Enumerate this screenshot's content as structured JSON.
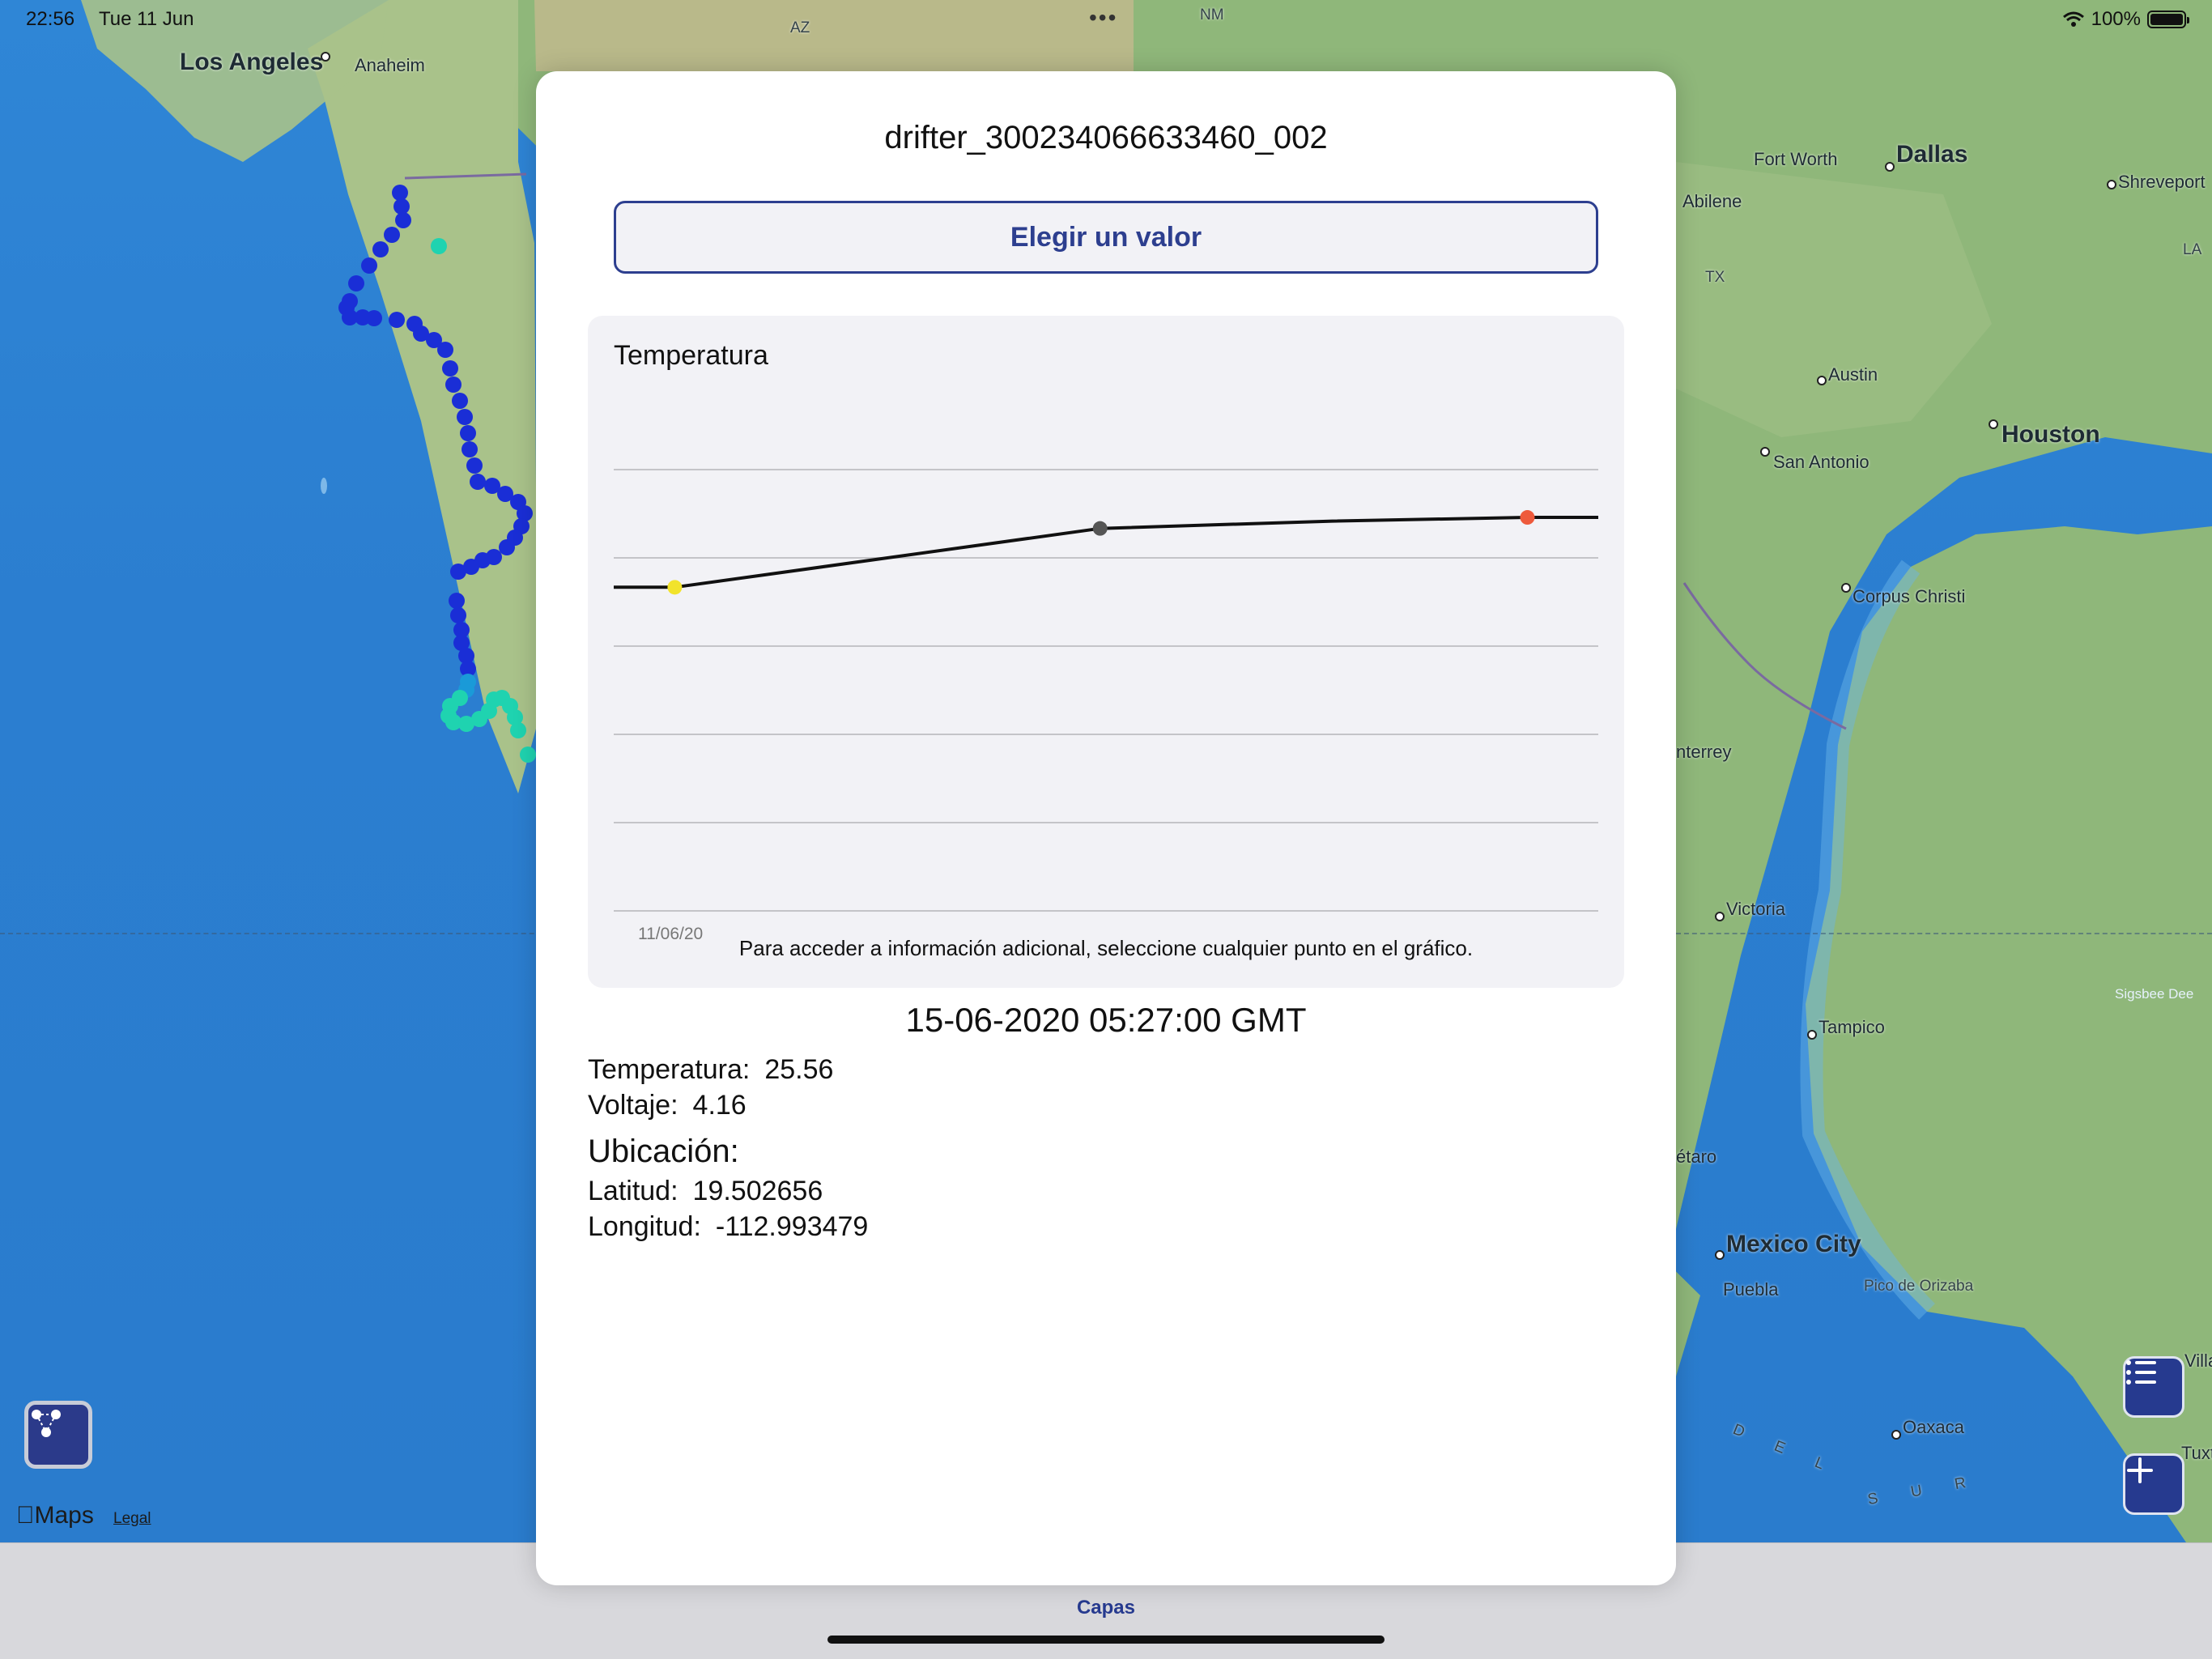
{
  "status_bar": {
    "time": "22:56",
    "date": "Tue 11 Jun",
    "multitask": "•••",
    "battery": "100%"
  },
  "map": {
    "labels": {
      "los_angeles": "Los Angeles",
      "anaheim": "Anaheim",
      "az": "AZ",
      "nm": "NM",
      "fort_worth": "Fort Worth",
      "dallas": "Dallas",
      "shreveport": "Shreveport",
      "abilene": "Abilene",
      "tx": "TX",
      "la": "LA",
      "austin": "Austin",
      "houston": "Houston",
      "san_antonio": "San Antonio",
      "corpus_christi": "Corpus Christi",
      "monterrey": "nterrey",
      "victoria": "Victoria",
      "sigsbee": "Sigsbee Dee",
      "tampico": "Tampico",
      "queretaro": "étaro",
      "mexico_city": "Mexico City",
      "puebla": "Puebla",
      "pico_orizaba": "Pico de Orizaba",
      "villa": "Villa",
      "oaxaca": "Oaxaca",
      "tuxtla": "Tuxtla",
      "del": "D E L",
      "sur": "S U R"
    },
    "attribution": {
      "logo": "Maps",
      "legal": "Legal"
    },
    "colors": {
      "water": "#2b7ed0",
      "land": "#8fb77a",
      "track_dark": "#1a2ed6",
      "track_light": "#1fd3b0"
    }
  },
  "modal": {
    "title": "drifter_300234066633460_002",
    "picker_label": "Elegir un valor",
    "chart_title": "Temperatura",
    "hint": "Para acceder a información adicional, seleccione cualquier punto en el gráfico.",
    "datetime": "15-06-2020 05:27:00 GMT",
    "temperature_label": "Temperatura:",
    "temperature_value": "25.56",
    "voltage_label": "Voltaje:",
    "voltage_value": "4.16",
    "location_heading": "Ubicación:",
    "latitude_label": "Latitud:",
    "latitude_value": "19.502656",
    "longitude_label": "Longitud:",
    "longitude_value": "-112.993479"
  },
  "chart_data": {
    "type": "line",
    "x_tick_labels": [
      "11/06/20"
    ],
    "grid": true,
    "series": [
      {
        "values": [
          25.4,
          25.4,
          26.2,
          26.3,
          26.35,
          26.35
        ]
      }
    ],
    "highlight_points": [
      {
        "index": 1,
        "color": "#f2e32b"
      },
      {
        "index": 2,
        "color": "#555555"
      },
      {
        "index": 4,
        "color": "#ee5a3c"
      }
    ],
    "ylim": [
      21.0,
      27.0
    ],
    "line_color": "#111111"
  },
  "tabbar": {
    "label": "Capas"
  }
}
